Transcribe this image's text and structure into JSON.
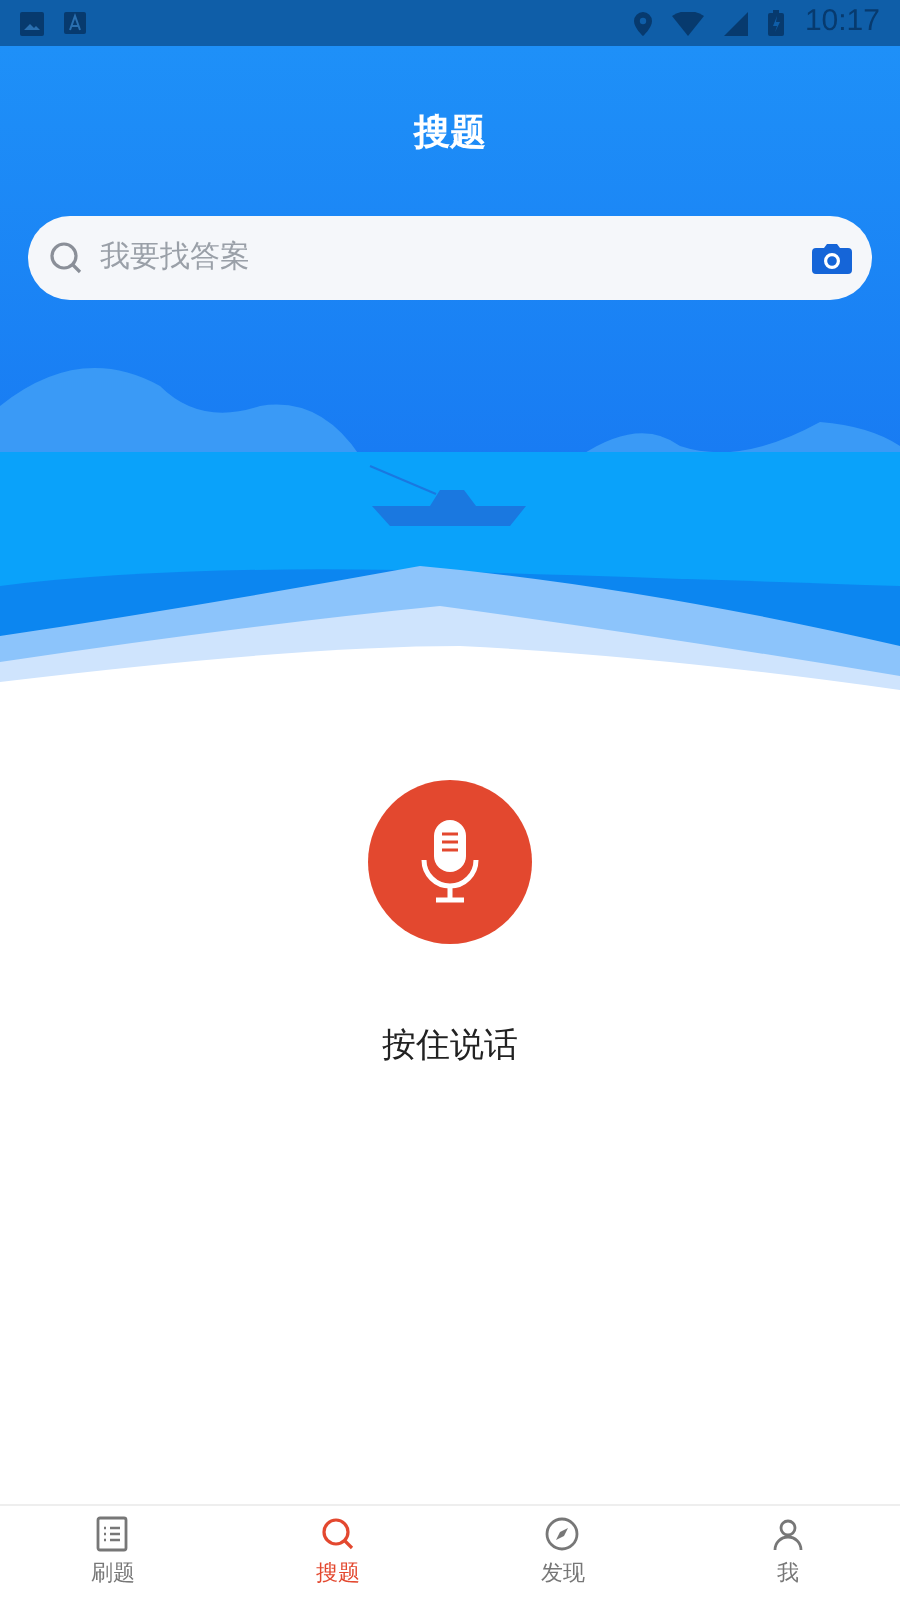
{
  "status_bar": {
    "time": "10:17"
  },
  "header": {
    "title": "搜题"
  },
  "search": {
    "placeholder": "我要找答案"
  },
  "voice": {
    "label": "按住说话"
  },
  "tabs": [
    {
      "label": "刷题",
      "kind": "list",
      "selected": false
    },
    {
      "label": "搜题",
      "kind": "search",
      "selected": true
    },
    {
      "label": "发现",
      "kind": "compass",
      "selected": false
    },
    {
      "label": "我",
      "kind": "person",
      "selected": false
    }
  ]
}
